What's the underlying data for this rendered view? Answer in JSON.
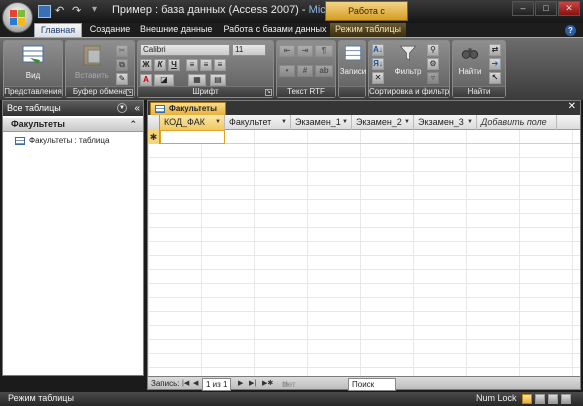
{
  "titlebar": {
    "document_title": "Пример : база данных (Access 2007)",
    "app_name": "Microsof...",
    "contextual_title": "Работа с таблицами",
    "minimize": "–",
    "maximize": "□",
    "close": "✕"
  },
  "tabs": [
    {
      "label": "Главная"
    },
    {
      "label": "Создание"
    },
    {
      "label": "Внешние данные"
    },
    {
      "label": "Работа с базами данных"
    },
    {
      "label": "Режим таблицы"
    }
  ],
  "ribbon": {
    "groups": {
      "views": "Представления",
      "clipboard": "Буфер обмена",
      "font": "Шрифт",
      "rich_text": "Текст RTF",
      "records": "",
      "sort_filter": "Сортировка и фильтр",
      "find": "Найти"
    },
    "view_button": "Вид",
    "paste_button": "Вставить",
    "font_name": "Calibri",
    "font_size": "11",
    "bold": "Ж",
    "italic": "К",
    "underline": "Ч",
    "records_button": "Записи",
    "filter_button": "Фильтр",
    "find_button": "Найти",
    "font_color_glyph": "A"
  },
  "nav_pane": {
    "header": "Все таблицы",
    "group_label": "Факультеты",
    "items": [
      {
        "label": "Факультеты : таблица"
      }
    ]
  },
  "document": {
    "tab_label": "Факультеты",
    "columns": [
      {
        "label": "КОД_ФАК"
      },
      {
        "label": "Факультет"
      },
      {
        "label": "Экзамен_1"
      },
      {
        "label": "Экзамен_2"
      },
      {
        "label": "Экзамен_3"
      },
      {
        "label": "Добавить поле"
      }
    ],
    "new_row_marker": "✱"
  },
  "record_nav": {
    "label": "Запись:",
    "position": "1 из 1",
    "filter_status": "Нет фильтра",
    "search_placeholder": "Поиск"
  },
  "status": {
    "mode": "Режим таблицы",
    "num_lock": "Num Lock"
  }
}
